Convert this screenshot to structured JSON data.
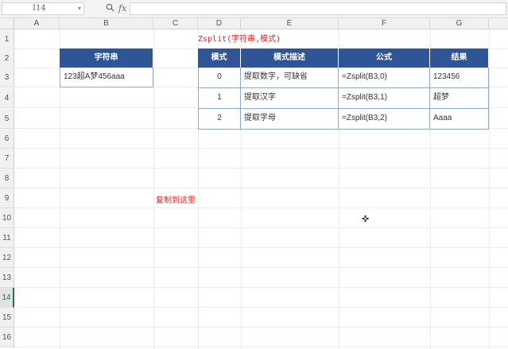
{
  "formula_bar": {
    "name_box": "I14",
    "zoom_icon": "magnifier-icon",
    "fx_label": "fx",
    "formula": ""
  },
  "columns": [
    "A",
    "B",
    "C",
    "D",
    "E",
    "F",
    "G"
  ],
  "rows": [
    "1",
    "2",
    "3",
    "4",
    "5",
    "6",
    "7",
    "8",
    "9",
    "10",
    "11",
    "12",
    "13",
    "14",
    "15",
    "16"
  ],
  "active_row": "14",
  "title": "Zsplit(字符串,模式)",
  "source_table": {
    "header": "字符串",
    "value": "123超A梦456aaa"
  },
  "mode_table": {
    "headers": [
      "模式",
      "模式描述",
      "公式",
      "结果"
    ],
    "rows": [
      [
        "0",
        "提取数字，可缺省",
        "=Zsplit(B3,0)",
        "123456"
      ],
      [
        "1",
        "提取汉字",
        "=Zsplit(B3,1)",
        "超梦"
      ],
      [
        "2",
        "提取字母",
        "=Zsplit(B3,2)",
        "Aaaa"
      ]
    ]
  },
  "note": "复制到这里",
  "colors": {
    "header_bg": "#2f5597",
    "accent_red": "#e02020",
    "active_green": "#217346"
  }
}
